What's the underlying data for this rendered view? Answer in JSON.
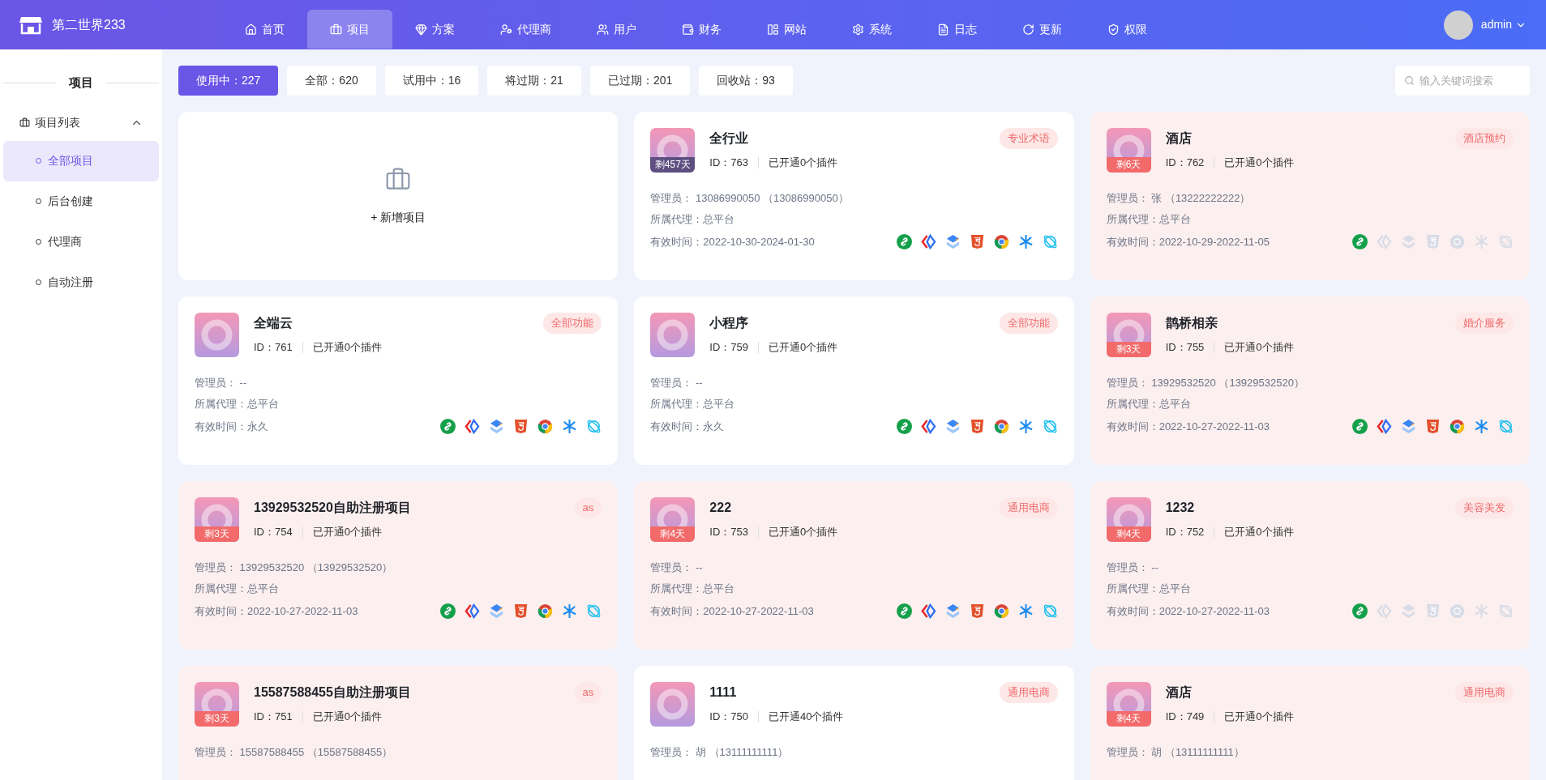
{
  "brand": {
    "name": "第二世界233"
  },
  "nav": [
    {
      "label": "首页",
      "selected": false
    },
    {
      "label": "项目",
      "selected": true
    },
    {
      "label": "方案",
      "selected": false
    },
    {
      "label": "代理商",
      "selected": false
    },
    {
      "label": "用户",
      "selected": false
    },
    {
      "label": "财务",
      "selected": false
    },
    {
      "label": "网站",
      "selected": false
    },
    {
      "label": "系统",
      "selected": false
    },
    {
      "label": "日志",
      "selected": false
    },
    {
      "label": "更新",
      "selected": false
    },
    {
      "label": "权限",
      "selected": false
    }
  ],
  "user": {
    "name": "admin"
  },
  "sidebar": {
    "title": "项目",
    "group": {
      "label": "项目列表",
      "expanded": true,
      "items": [
        {
          "label": "全部项目",
          "selected": true
        },
        {
          "label": "后台创建",
          "selected": false
        },
        {
          "label": "代理商",
          "selected": false
        },
        {
          "label": "自动注册",
          "selected": false
        }
      ]
    }
  },
  "filters": [
    {
      "label": "使用中：227",
      "selected": true
    },
    {
      "label": "全部：620",
      "selected": false
    },
    {
      "label": "试用中：16",
      "selected": false
    },
    {
      "label": "将过期：21",
      "selected": false
    },
    {
      "label": "已过期：201",
      "selected": false
    },
    {
      "label": "回收站：93",
      "selected": false
    }
  ],
  "search": {
    "placeholder": "输入关键词搜索"
  },
  "new_project": {
    "label": "+ 新增项目"
  },
  "projects": [
    {
      "name": "全行业",
      "tag": "专业术语",
      "expiring": false,
      "days": {
        "text": "剩457天",
        "kind": "dark"
      },
      "id": "ID：763",
      "plugins_text": "已开通0个插件",
      "admin": "管理员： 13086990050 （13086990050）",
      "agent": "所属代理：总平台",
      "period": "有效时间：2022-10-30-2024-01-30",
      "plugins": [
        true,
        true,
        true,
        true,
        true,
        true,
        true
      ]
    },
    {
      "name": "酒店",
      "tag": "酒店预约",
      "expiring": true,
      "days": {
        "text": "剩6天",
        "kind": "red"
      },
      "id": "ID：762",
      "plugins_text": "已开通0个插件",
      "admin": "管理员： 张 （13222222222）",
      "agent": "所属代理：总平台",
      "period": "有效时间：2022-10-29-2022-11-05",
      "plugins": [
        true,
        false,
        false,
        false,
        false,
        false,
        false
      ]
    },
    {
      "name": "全端云",
      "tag": "全部功能",
      "expiring": false,
      "id": "ID：761",
      "plugins_text": "已开通0个插件",
      "admin": "管理员： --",
      "agent": "所属代理：总平台",
      "period": "有效时间：永久",
      "plugins": [
        true,
        true,
        true,
        true,
        true,
        true,
        true
      ]
    },
    {
      "name": "小程序",
      "tag": "全部功能",
      "expiring": false,
      "id": "ID：759",
      "plugins_text": "已开通0个插件",
      "admin": "管理员： --",
      "agent": "所属代理：总平台",
      "period": "有效时间：永久",
      "plugins": [
        true,
        true,
        true,
        true,
        true,
        true,
        true
      ]
    },
    {
      "name": "鹊桥相亲",
      "tag": "婚介服务",
      "expiring": true,
      "days": {
        "text": "剩3天",
        "kind": "red"
      },
      "id": "ID：755",
      "plugins_text": "已开通0个插件",
      "admin": "管理员： 13929532520 （13929532520）",
      "agent": "所属代理：总平台",
      "period": "有效时间：2022-10-27-2022-11-03",
      "plugins": [
        true,
        true,
        true,
        true,
        true,
        true,
        true
      ]
    },
    {
      "name": "13929532520自助注册项目",
      "tag": "as",
      "expiring": true,
      "days": {
        "text": "剩3天",
        "kind": "red"
      },
      "id": "ID：754",
      "plugins_text": "已开通0个插件",
      "admin": "管理员： 13929532520 （13929532520）",
      "agent": "所属代理：总平台",
      "period": "有效时间：2022-10-27-2022-11-03",
      "plugins": [
        true,
        true,
        true,
        true,
        true,
        true,
        true
      ]
    },
    {
      "name": "222",
      "tag": "通用电商",
      "expiring": true,
      "days": {
        "text": "剩4天",
        "kind": "red"
      },
      "id": "ID：753",
      "plugins_text": "已开通0个插件",
      "admin": "管理员： --",
      "agent": "所属代理：总平台",
      "period": "有效时间：2022-10-27-2022-11-03",
      "plugins": [
        true,
        true,
        true,
        true,
        true,
        true,
        true
      ]
    },
    {
      "name": "1232",
      "tag": "美容美发",
      "expiring": true,
      "days": {
        "text": "剩4天",
        "kind": "red"
      },
      "id": "ID：752",
      "plugins_text": "已开通0个插件",
      "admin": "管理员： --",
      "agent": "所属代理：总平台",
      "period": "有效时间：2022-10-27-2022-11-03",
      "plugins": [
        true,
        false,
        false,
        false,
        false,
        false,
        false
      ]
    },
    {
      "name": "15587588455自助注册项目",
      "tag": "as",
      "expiring": true,
      "days": {
        "text": "剩3天",
        "kind": "red"
      },
      "id": "ID：751",
      "plugins_text": "已开通0个插件",
      "admin": "管理员： 15587588455 （15587588455）"
    },
    {
      "name": "1111",
      "tag": "通用电商",
      "expiring": false,
      "id": "ID：750",
      "plugins_text": "已开通40个插件",
      "admin": "管理员： 胡 （13111111111）"
    },
    {
      "name": "酒店",
      "tag": "通用电商",
      "expiring": true,
      "days": {
        "text": "剩4天",
        "kind": "red"
      },
      "id": "ID：749",
      "plugins_text": "已开通0个插件",
      "admin": "管理员： 胡 （13111111111）"
    }
  ]
}
